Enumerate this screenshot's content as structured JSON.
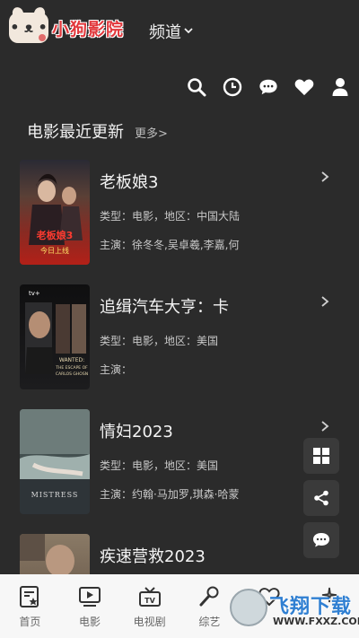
{
  "header": {
    "logo_text": "小狗影院",
    "channel_label": "频道"
  },
  "section": {
    "title": "电影最近更新",
    "more_label": "更多>"
  },
  "movies": [
    {
      "title": "老板娘3",
      "meta": "类型：电影，地区：中国大陆",
      "cast": "主演：徐冬冬,吴卓羲,李嘉,何",
      "poster_text": "今日上线"
    },
    {
      "title": "追缉汽车大亨：卡",
      "meta": "类型：电影，地区：美国",
      "cast": "主演：",
      "poster_text": "WANTED: THE ESCAPE OF CARLOS GHOSN"
    },
    {
      "title": "情妇2023",
      "meta": "类型：电影，地区：美国",
      "cast": "主演：约翰·马加罗,琪森·哈蒙",
      "poster_text": "MISTRESS"
    },
    {
      "title": "疾速营救2023",
      "meta": "",
      "cast": "",
      "poster_text": ""
    }
  ],
  "bottom_nav": [
    {
      "label": "首页",
      "icon": "home-star-icon"
    },
    {
      "label": "电影",
      "icon": "tv-play-icon"
    },
    {
      "label": "电视剧",
      "icon": "retro-tv-icon"
    },
    {
      "label": "综艺",
      "icon": "microphone-icon"
    }
  ],
  "watermark": {
    "text": "飞翔下载",
    "url": "WWW.FXXZ.COM"
  },
  "colors": {
    "background": "#2b2b2b",
    "bottom_bar": "#f7f7f7",
    "logo_red": "#e2383c"
  }
}
